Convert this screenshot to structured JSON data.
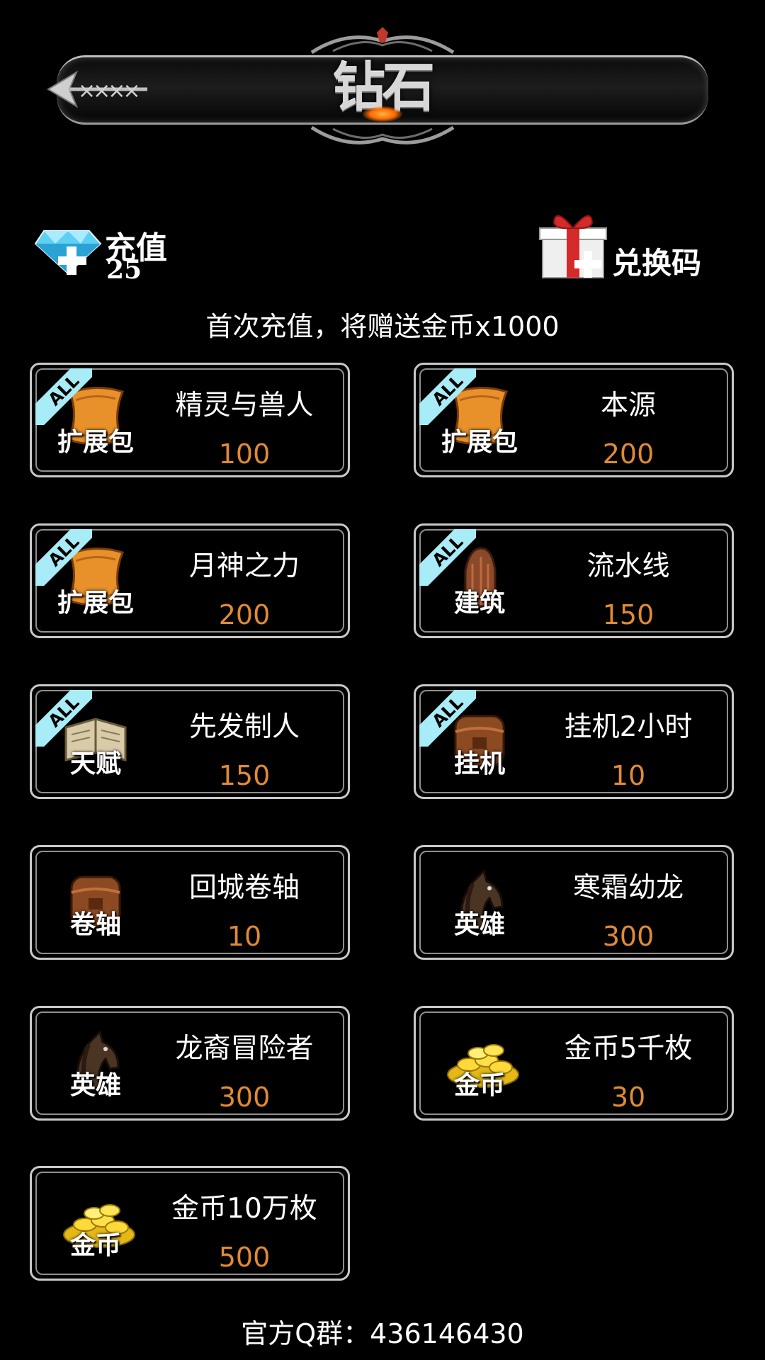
{
  "header": {
    "title": "钻石",
    "back_icon": "arrow-back-icon"
  },
  "recharge": {
    "label": "充值",
    "diamond_count": "25",
    "icon": "diamond-plus-icon"
  },
  "redeem": {
    "label": "兑换码",
    "icon": "gift-plus-icon"
  },
  "notice": "首次充值，将赠送金币x1000",
  "items": [
    {
      "name": "精灵与兽人",
      "price": "100",
      "caption": "扩展包",
      "icon": "scroll-icon",
      "all_badge": "ALL"
    },
    {
      "name": "本源",
      "price": "200",
      "caption": "扩展包",
      "icon": "scroll-icon",
      "all_badge": "ALL"
    },
    {
      "name": "月神之力",
      "price": "200",
      "caption": "扩展包",
      "icon": "scroll-icon",
      "all_badge": "ALL"
    },
    {
      "name": "流水线",
      "price": "150",
      "caption": "建筑",
      "icon": "building-icon",
      "all_badge": "ALL"
    },
    {
      "name": "先发制人",
      "price": "150",
      "caption": "天赋",
      "icon": "book-icon",
      "all_badge": "ALL"
    },
    {
      "name": "挂机2小时",
      "price": "10",
      "caption": "挂机",
      "icon": "backpack-icon",
      "all_badge": "ALL"
    },
    {
      "name": "回城卷轴",
      "price": "10",
      "caption": "卷轴",
      "icon": "backpack-icon",
      "all_badge": ""
    },
    {
      "name": "寒霜幼龙",
      "price": "300",
      "caption": "英雄",
      "icon": "horse-icon",
      "all_badge": ""
    },
    {
      "name": "龙裔冒险者",
      "price": "300",
      "caption": "英雄",
      "icon": "horse-icon",
      "all_badge": ""
    },
    {
      "name": "金币5千枚",
      "price": "30",
      "caption": "金币",
      "icon": "gold-coins-icon",
      "all_badge": ""
    },
    {
      "name": "金币10万枚",
      "price": "500",
      "caption": "金币",
      "icon": "gold-coins-icon",
      "all_badge": ""
    }
  ],
  "footer": "官方Q群：436146430",
  "colors": {
    "price": "#e08a35",
    "badge": "#a8ecf7",
    "background": "#000000"
  }
}
